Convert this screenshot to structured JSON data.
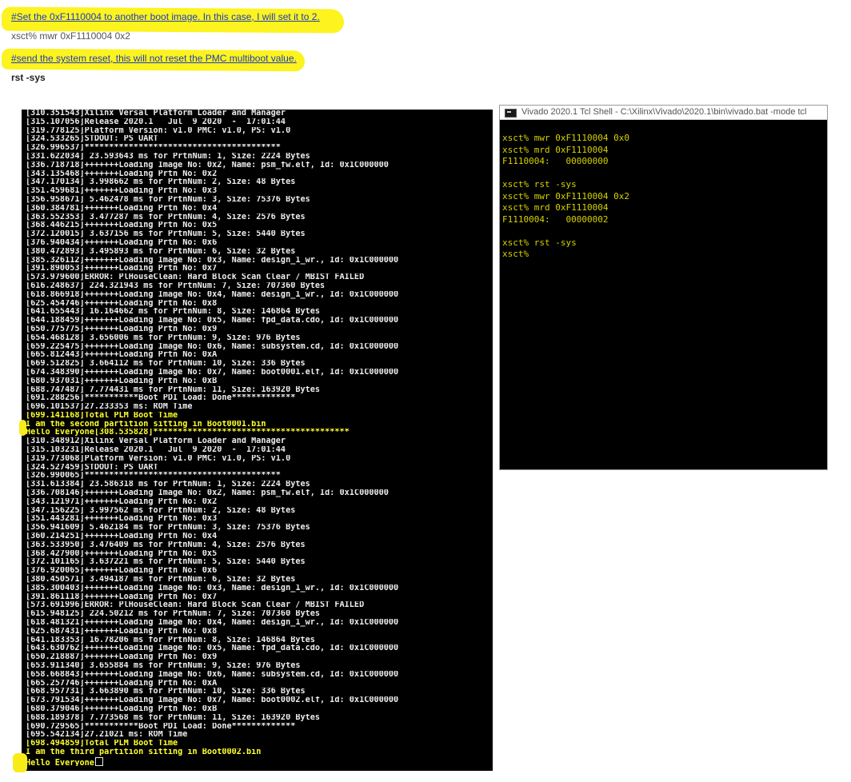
{
  "doc": {
    "comment1": "#Set the 0xF1110004 to another boot image. In this case, I will set it to 2.",
    "cmd1": "xsct% mwr 0xF1110004 0x2",
    "comment2": "#send the system reset, this will not reset the PMC multiboot value.",
    "cmd2": "rst -sys"
  },
  "colors": {
    "highlight": "#fcf31f",
    "link": "#1e3cbf",
    "console_bg": "#000000",
    "console_text": "#ececec",
    "console_highlight_text": "#ffff2e",
    "tcl_text": "#d7d200"
  },
  "console": {
    "lines": [
      "[310.351543]Xilinx Versal Platform Loader and Manager",
      "[315.107056]Release 2020.1   Jul  9 2020  -  17:01:44",
      "[319.778125]Platform Version: v1.0 PMC: v1.0, PS: v1.0",
      "[324.533265]STDOUT: PS UART",
      "[326.996537]****************************************",
      "[331.622034] 23.593643 ms for PrtnNum: 1, Size: 2224 Bytes",
      "[336.718718]+++++++Loading Image No: 0x2, Name: psm_fw.elf, Id: 0x1C000000",
      "[343.135468]+++++++Loading Prtn No: 0x2",
      "[347.170134] 3.998662 ms for PrtnNum: 2, Size: 48 Bytes",
      "[351.459681]+++++++Loading Prtn No: 0x3",
      "[356.958671] 5.462478 ms for PrtnNum: 3, Size: 75376 Bytes",
      "[360.384781]+++++++Loading Prtn No: 0x4",
      "[363.552353] 3.477287 ms for PrtnNum: 4, Size: 2576 Bytes",
      "[368.446215]+++++++Loading Prtn No: 0x5",
      "[372.120015] 3.637156 ms for PrtnNum: 5, Size: 5440 Bytes",
      "[376.940434]+++++++Loading Prtn No: 0x6",
      "[380.472893] 3.495893 ms for PrtnNum: 6, Size: 32 Bytes",
      "[385.326112]+++++++Loading Image No: 0x3, Name: design_1_wr., Id: 0x1C000000",
      "[391.890053]+++++++Loading Prtn No: 0x7",
      "[573.979600]ERROR: PlHouseClean: Hard Block Scan Clear / MBIST FAILED",
      "[616.248637] 224.321943 ms for PrtnNum: 7, Size: 707360 Bytes",
      "[618.866918]+++++++Loading Image No: 0x4, Name: design_1_wr., Id: 0x1C000000",
      "[625.454746]+++++++Loading Prtn No: 0x8",
      "[641.655443] 16.164662 ms for PrtnNum: 8, Size: 146864 Bytes",
      "[644.188459]+++++++Loading Image No: 0x5, Name: fpd_data.cdo, Id: 0x1C000000",
      "[650.775775]+++++++Loading Prtn No: 0x9",
      "[654.468128] 3.656006 ms for PrtnNum: 9, Size: 976 Bytes",
      "[659.225475]+++++++Loading Image No: 0x6, Name: subsystem.cd, Id: 0x1C000000",
      "[665.812443]+++++++Loading Prtn No: 0xA",
      "[669.512825] 3.664112 ms for PrtnNum: 10, Size: 336 Bytes",
      "[674.348390]+++++++Loading Image No: 0x7, Name: boot0001.elf, Id: 0x1C000000",
      "[680.937031]+++++++Loading Prtn No: 0xB",
      "[688.747487] 7.774431 ms for PrtnNum: 11, Size: 163920 Bytes",
      "[691.288256]***********Boot PDI Load: Done*************",
      "[696.101537]27.233353 ms: ROM Time",
      "[699.141168]Total PLM Boot Time",
      "I am the second partition sitting in Boot0001.bin",
      "Hello Everyone[308.535828]****************************************",
      "[310.348912]Xilinx Versal Platform Loader and Manager",
      "[315.103231]Release 2020.1   Jul  9 2020  -  17:01:44",
      "[319.773068]Platform Version: v1.0 PMC: v1.0, PS: v1.0",
      "[324.527459]STDOUT: PS UART",
      "[326.990065]****************************************",
      "[331.613384] 23.586318 ms for PrtnNum: 1, Size: 2224 Bytes",
      "[336.708146]+++++++Loading Image No: 0x2, Name: psm_fw.elf, Id: 0x1C000000",
      "[343.121971]+++++++Loading Prtn No: 0x2",
      "[347.156225] 3.997562 ms for PrtnNum: 2, Size: 48 Bytes",
      "[351.443281]+++++++Loading Prtn No: 0x3",
      "[356.941609] 5.462184 ms for PrtnNum: 3, Size: 75376 Bytes",
      "[360.214251]+++++++Loading Prtn No: 0x4",
      "[363.533950] 3.476409 ms for PrtnNum: 4, Size: 2576 Bytes",
      "[368.427900]+++++++Loading Prtn No: 0x5",
      "[372.101165] 3.637221 ms for PrtnNum: 5, Size: 5440 Bytes",
      "[376.920065]+++++++Loading Prtn No: 0x6",
      "[380.450571] 3.494187 ms for PrtnNum: 6, Size: 32 Bytes",
      "[385.300403]+++++++Loading Image No: 0x3, Name: design_1_wr., Id: 0x1C000000",
      "[391.861118]+++++++Loading Prtn No: 0x7",
      "[573.691996]ERROR: PlHouseClean: Hard Block Scan Clear / MBIST FAILED",
      "[615.948125] 224.50212 ms for PrtnNum: 7, Size: 707360 Bytes",
      "[618.481321]+++++++Loading Image No: 0x4, Name: design_1_wr., Id: 0x1C000000",
      "[625.687431]+++++++Loading Prtn No: 0x8",
      "[641.183353] 16.78206 ms for PrtnNum: 8, Size: 146864 Bytes",
      "[643.630762]+++++++Loading Image No: 0x5, Name: fpd_data.cdo, Id: 0x1C000000",
      "[650.218887]+++++++Loading Prtn No: 0x9",
      "[653.911340] 3.655884 ms for PrtnNum: 9, Size: 976 Bytes",
      "[658.668843]+++++++Loading Image No: 0x6, Name: subsystem.cd, Id: 0x1C000000",
      "[665.257746]+++++++Loading Prtn No: 0xA",
      "[668.957731] 3.663890 ms for PrtnNum: 10, Size: 336 Bytes",
      "[673.791534]+++++++Loading Image No: 0x7, Name: boot0002.elf, Id: 0x1C000000",
      "[680.379046]+++++++Loading Prtn No: 0xB",
      "[688.189378] 7.773568 ms for PrtnNum: 11, Size: 163920 Bytes",
      "[690.729565]***********Boot PDI Load: Done*************",
      "[695.542134]27.21021 ms: ROM Time",
      "[698.494859]Total PLM Boot Time",
      "I am the third partition sitting in Boot0002.bin",
      "Hello Everyone"
    ]
  },
  "tcl": {
    "title": "Vivado 2020.1 Tcl Shell - C:\\Xilinx\\Vivado\\2020.1\\bin\\vivado.bat -mode tcl",
    "lines": [
      "xsct% mwr 0xF1110004 0x0",
      "xsct% mrd 0xF1110004",
      "F1110004:   00000000",
      "",
      "xsct% rst -sys",
      "xsct% mwr 0xF1110004 0x2",
      "xsct% mrd 0xF1110004",
      "F1110004:   00000002",
      "",
      "xsct% rst -sys",
      "xsct%"
    ]
  }
}
